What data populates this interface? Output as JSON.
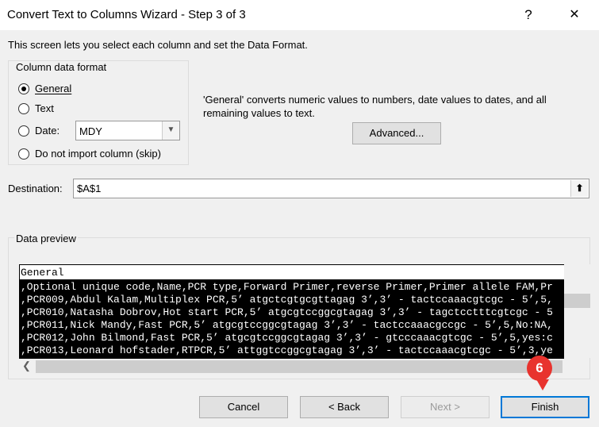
{
  "window": {
    "title": "Convert Text to Columns Wizard - Step 3 of 3",
    "help": "?",
    "close": "✕"
  },
  "intro": "This screen lets you select each column and set the Data Format.",
  "format_group": {
    "legend": "Column data format",
    "options": [
      {
        "label": "General",
        "selected": true
      },
      {
        "label": "Text",
        "selected": false
      },
      {
        "label": "Date:",
        "selected": false
      },
      {
        "label": "Do not import column (skip)",
        "selected": false
      }
    ],
    "date_format": "MDY"
  },
  "description": "'General' converts numeric values to numbers, date values to dates, and all remaining values to text.",
  "advanced_label": "Advanced...",
  "destination": {
    "label": "Destination:",
    "value": "$A$1"
  },
  "preview": {
    "legend": "Data preview",
    "column_header": "General",
    "rows": [
      ",Optional unique code,Name,PCR type,Forward Primer,reverse Primer,Primer allele FAM,Pr",
      ",PCR009,Abdul Kalam,Multiplex PCR,5’ atgctcgtgcgttagag 3’,3’ - tactccaaacgtcgc - 5’,5,",
      ",PCR010,Natasha Dobrov,Hot start PCR,5’ atgcgtccggcgtagag 3’,3’ - tagctcctttcgtcgc - 5",
      ",PCR011,Nick Mandy,Fast PCR,5’ atgcgtccggcgtagag 3’,3’ - tactccaaacgccgc - 5’,5,No:NA,",
      ",PCR012,John Bilmond,Fast PCR,5’ atgcgtccggcgtagag 3’,3’ - gtcccaaacgtcgc - 5’,5,yes:c",
      ",PCR013,Leonard hofstader,RTPCR,5’ attggtccggcgtagag 3’,3’ - tactccaaacgtcgc - 5’,3,ye"
    ]
  },
  "buttons": {
    "cancel": "Cancel",
    "back": "< Back",
    "next": "Next >",
    "finish": "Finish"
  },
  "step_badge": "6",
  "colors": {
    "badge": "#e8332e",
    "default_button_border": "#0078d7"
  }
}
